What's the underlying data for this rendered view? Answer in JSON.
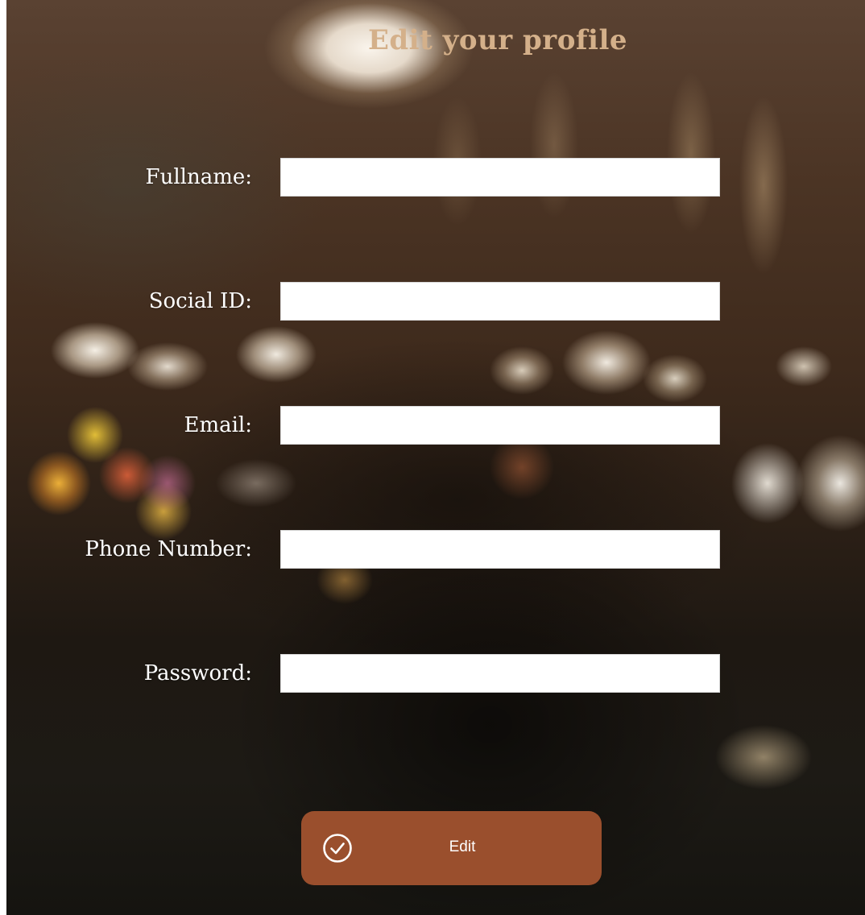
{
  "page": {
    "title": "Edit your profile"
  },
  "form": {
    "fields": [
      {
        "label": "Fullname:",
        "value": "",
        "placeholder": ""
      },
      {
        "label": "Social ID:",
        "value": "",
        "placeholder": ""
      },
      {
        "label": "Email:",
        "value": "",
        "placeholder": ""
      },
      {
        "label": "Phone Number:",
        "value": "",
        "placeholder": ""
      },
      {
        "label": "Password:",
        "value": "",
        "placeholder": ""
      }
    ],
    "submit": {
      "label": "Edit",
      "icon": "check-circle-icon",
      "color": "#9a4f2d"
    }
  },
  "colors": {
    "title": "#d4b08a",
    "label": "#ffffff",
    "input_bg": "#ffffff"
  }
}
